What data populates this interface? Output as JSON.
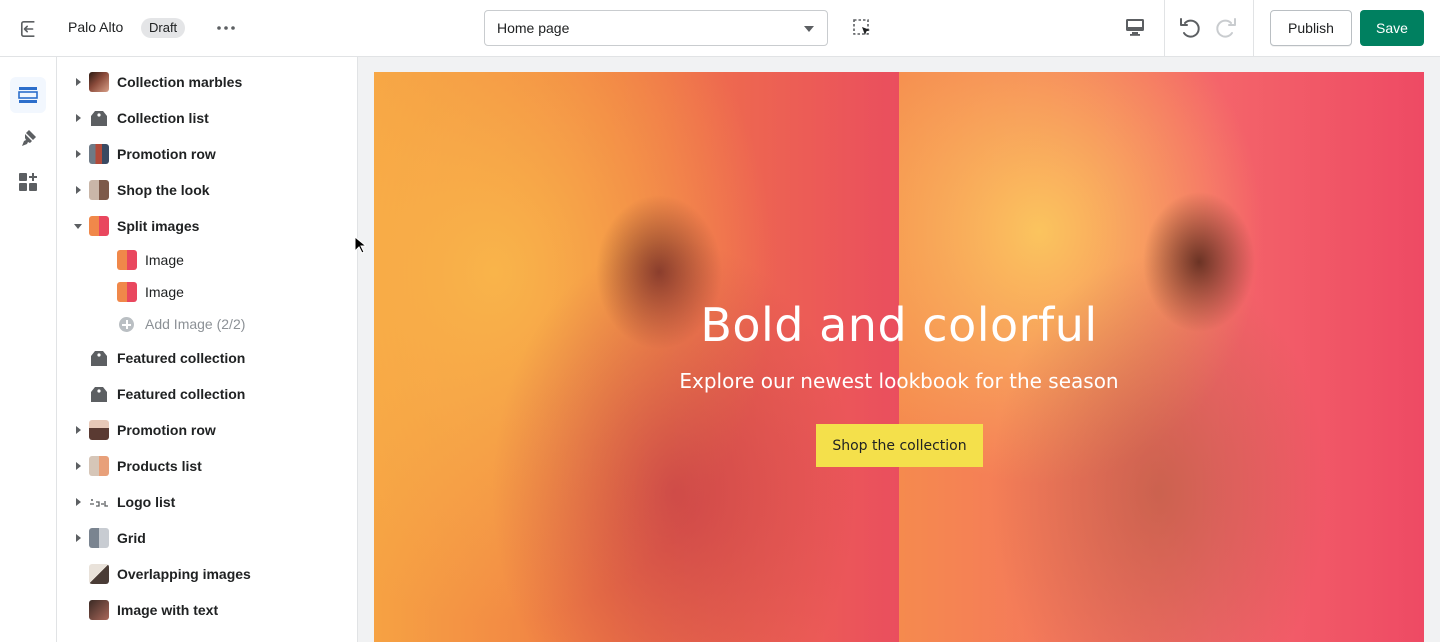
{
  "topbar": {
    "store_name": "Palo Alto",
    "status_badge": "Draft",
    "page_select_value": "Home page",
    "publish_label": "Publish",
    "save_label": "Save"
  },
  "rail": {
    "items": [
      {
        "icon": "sections-icon",
        "active": true
      },
      {
        "icon": "theme-settings-icon",
        "active": false
      },
      {
        "icon": "apps-icon",
        "active": false
      }
    ]
  },
  "sections": [
    {
      "label": "Collection marbles",
      "thumb": "photo",
      "expandable": true
    },
    {
      "label": "Collection list",
      "thumb": "tag",
      "expandable": true
    },
    {
      "label": "Promotion row",
      "thumb": "promo",
      "expandable": true
    },
    {
      "label": "Shop the look",
      "thumb": "look",
      "expandable": true
    },
    {
      "label": "Split images",
      "thumb": "split",
      "expandable": true,
      "expanded": true,
      "children": [
        {
          "label": "Image"
        },
        {
          "label": "Image"
        }
      ],
      "add_label": "Add Image (2/2)"
    },
    {
      "label": "Featured collection",
      "thumb": "tag",
      "expandable": false
    },
    {
      "label": "Featured collection",
      "thumb": "tag",
      "expandable": false
    },
    {
      "label": "Promotion row",
      "thumb": "promo2",
      "expandable": true
    },
    {
      "label": "Products list",
      "thumb": "products",
      "expandable": true
    },
    {
      "label": "Logo list",
      "thumb": "logo",
      "expandable": true
    },
    {
      "label": "Grid",
      "thumb": "grid",
      "expandable": true
    },
    {
      "label": "Overlapping images",
      "thumb": "overlap",
      "expandable": false
    },
    {
      "label": "Image with text",
      "thumb": "imgtext",
      "expandable": false
    }
  ],
  "preview": {
    "hero_title": "Bold and colorful",
    "hero_subtitle": "Explore our newest lookbook for the season",
    "hero_button": "Shop the collection",
    "button_color": "#f4e04b",
    "save_color": "#008060"
  }
}
